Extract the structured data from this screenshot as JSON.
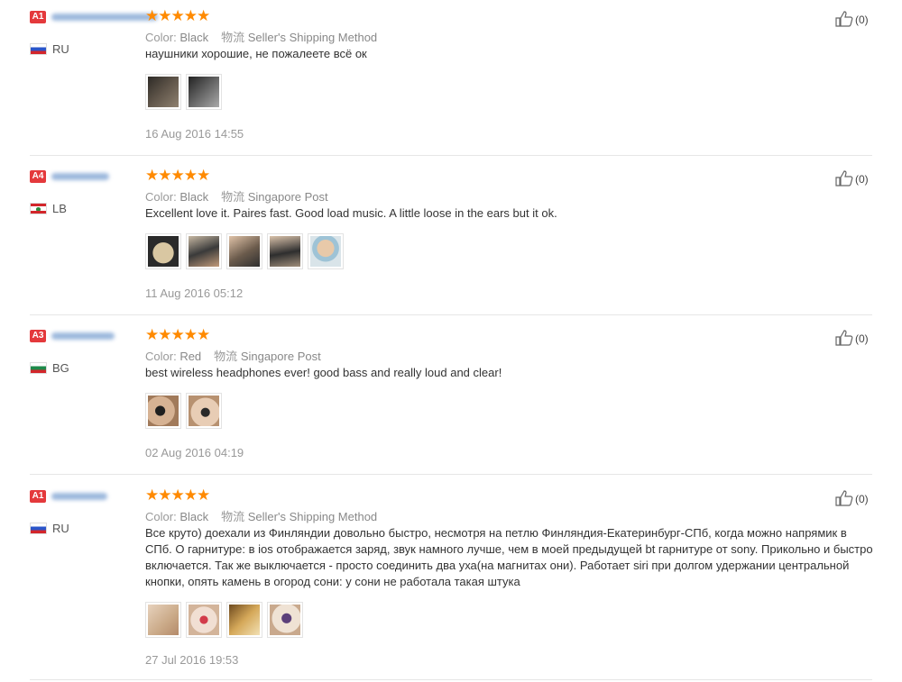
{
  "reviews": [
    {
      "badge": "A1",
      "country": "RU",
      "stars": 5,
      "color_label": "Color:",
      "color": "Black",
      "ship_label": "物流",
      "ship": "Seller's Shipping Method",
      "text": "наушники хорошие, не пожалеете всё ок",
      "date": "16 Aug 2016 14:55",
      "likes": "(0)"
    },
    {
      "badge": "A4",
      "country": "LB",
      "stars": 5,
      "color_label": "Color:",
      "color": "Black",
      "ship_label": "物流",
      "ship": "Singapore Post",
      "text": "Excellent love it. Paires fast. Good load music. A little loose in the ears but it ok.",
      "date": "11 Aug 2016 05:12",
      "likes": "(0)"
    },
    {
      "badge": "A3",
      "country": "BG",
      "stars": 5,
      "color_label": "Color:",
      "color": "Red",
      "ship_label": "物流",
      "ship": "Singapore Post",
      "text": "best wireless headphones ever! good bass and really loud and clear!",
      "date": "02 Aug 2016 04:19",
      "likes": "(0)"
    },
    {
      "badge": "A1",
      "country": "RU",
      "stars": 5,
      "color_label": "Color:",
      "color": "Black",
      "ship_label": "物流",
      "ship": "Seller's Shipping Method",
      "text": "Все круто) доехали из Финляндии довольно быстро, несмотря на петлю Финляндия-Екатеринбург-СПб, когда можно напрямик в СПб. О гарнитуре: в ios отображается заряд, звук намного лучше, чем в моей предыдущей bt гарнитуре от sony. Прикольно и быстро включается. Так же выключается - просто соединить два уха(на магнитах они). Работает siri при долгом удержании центральной кнопки, опять камень в огород сони: у сони не работала такая штука",
      "date": "27 Jul 2016 19:53",
      "likes": "(0)"
    }
  ],
  "colors": {
    "badge": "#e4393c",
    "star": "#ff8a00",
    "divider": "#e6e6e6"
  },
  "icons": {
    "star": "star-icon",
    "like": "thumbs-up-icon"
  }
}
